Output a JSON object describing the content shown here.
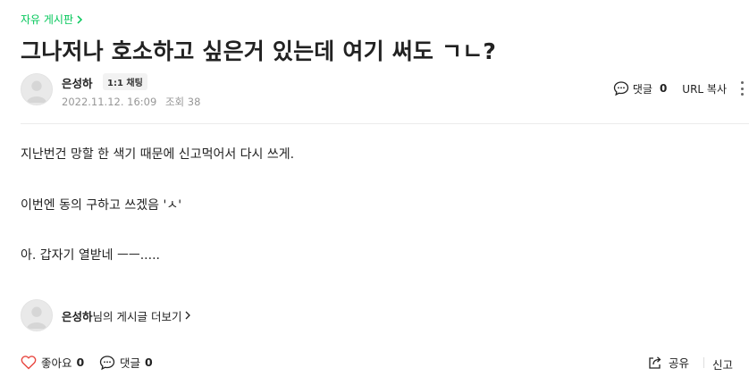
{
  "breadcrumb": {
    "board_name": "자유 게시판"
  },
  "post": {
    "title": "그나저나 호소하고 싶은거 있는데 여기 써도 ㄱㄴ?",
    "author": "은성하",
    "chat_badge": "1:1 채팅",
    "date": "2022.11.12. 16:09",
    "views_label": "조회",
    "views": "38",
    "paragraphs": [
      "지난번건 망할 한 색기 때문에 신고먹어서 다시 쓰게.",
      "이번엔 동의 구하고 쓰겠음 'ㅅ'",
      "아. 갑자기 열받네 ㅡㅡ....."
    ]
  },
  "toolbar": {
    "comment_label": "댓글",
    "comment_count": "0",
    "url_copy_label": "URL 복사"
  },
  "more_posts": {
    "author": "은성하",
    "suffix": "님의 게시글 더보기"
  },
  "footer": {
    "like_label": "좋아요",
    "like_count": "0",
    "comment_label": "댓글",
    "comment_count": "0",
    "share_label": "공유",
    "report_label": "신고"
  },
  "colors": {
    "accent": "#03c75a",
    "like": "#e8463f",
    "meta": "#979797"
  },
  "icons": [
    "chevron-right-icon",
    "avatar-icon",
    "comment-icon",
    "more-icon",
    "heart-icon",
    "share-icon"
  ]
}
